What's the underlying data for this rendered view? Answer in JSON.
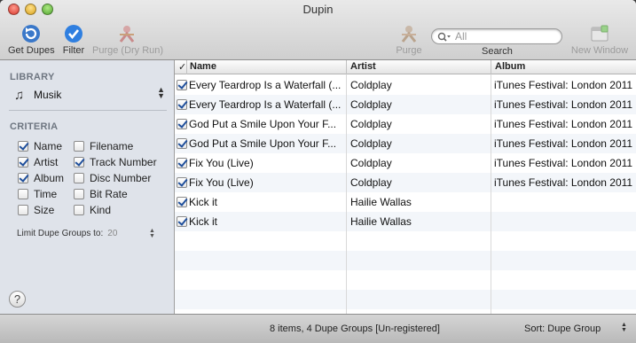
{
  "window": {
    "title": "Dupin"
  },
  "toolbar": {
    "get_dupes": "Get Dupes",
    "filter": "Filter",
    "purge_dry_run": "Purge (Dry Run)",
    "purge": "Purge",
    "search_label": "Search",
    "search_placeholder": "All",
    "new_window": "New Window"
  },
  "sidebar": {
    "library_header": "LIBRARY",
    "library_value": "Musik",
    "criteria_header": "CRITERIA",
    "criteria": [
      {
        "label": "Name",
        "checked": true
      },
      {
        "label": "Filename",
        "checked": false
      },
      {
        "label": "Artist",
        "checked": true
      },
      {
        "label": "Track Number",
        "checked": true
      },
      {
        "label": "Album",
        "checked": true
      },
      {
        "label": "Disc Number",
        "checked": false
      },
      {
        "label": "Time",
        "checked": false
      },
      {
        "label": "Bit Rate",
        "checked": false
      },
      {
        "label": "Size",
        "checked": false
      },
      {
        "label": "Kind",
        "checked": false
      }
    ],
    "limit_label": "Limit Dupe Groups to:",
    "limit_value": "20",
    "help": "?"
  },
  "table": {
    "check_header": "✓",
    "columns": [
      "Name",
      "Artist",
      "Album"
    ],
    "rows": [
      {
        "checked": true,
        "name": "Every Teardrop Is a Waterfall (...",
        "artist": "Coldplay",
        "album": "iTunes Festival: London 2011"
      },
      {
        "checked": true,
        "name": "Every Teardrop Is a Waterfall (...",
        "artist": "Coldplay",
        "album": "iTunes Festival: London 2011"
      },
      {
        "checked": true,
        "name": "God Put a Smile Upon Your F...",
        "artist": "Coldplay",
        "album": "iTunes Festival: London 2011"
      },
      {
        "checked": true,
        "name": "God Put a Smile Upon Your F...",
        "artist": "Coldplay",
        "album": "iTunes Festival: London 2011"
      },
      {
        "checked": true,
        "name": "Fix You (Live)",
        "artist": "Coldplay",
        "album": "iTunes Festival: London 2011"
      },
      {
        "checked": true,
        "name": "Fix You (Live)",
        "artist": "Coldplay",
        "album": "iTunes Festival: London 2011"
      },
      {
        "checked": true,
        "name": "Kick it",
        "artist": "Hailie Wallas",
        "album": ""
      },
      {
        "checked": true,
        "name": "Kick it",
        "artist": "Hailie Wallas",
        "album": ""
      }
    ]
  },
  "status": {
    "summary": "8 items, 4 Dupe Groups [Un-registered]",
    "sort": "Sort: Dupe Group"
  }
}
